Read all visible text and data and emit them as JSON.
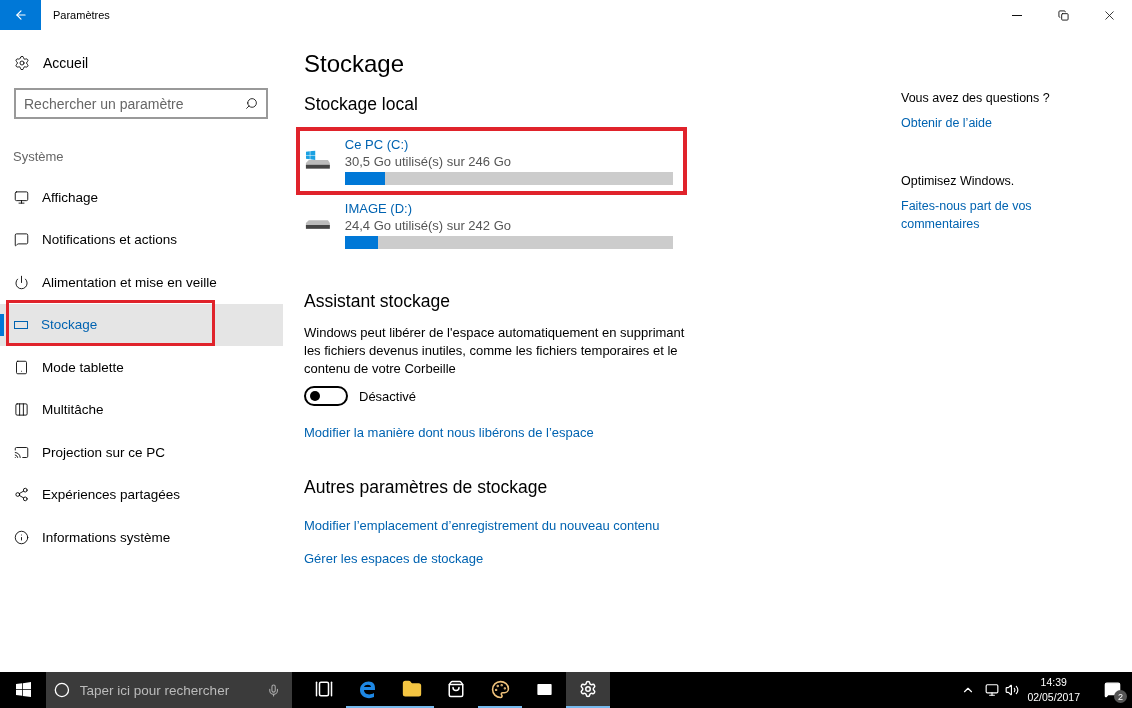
{
  "window": {
    "title": "Paramètres"
  },
  "sidebar": {
    "home": "Accueil",
    "search": {
      "placeholder": "Rechercher un paramètre"
    },
    "section": "Système",
    "items": [
      {
        "label": "Affichage",
        "selected": false,
        "highlighted": false
      },
      {
        "label": "Notifications et actions",
        "selected": false,
        "highlighted": false
      },
      {
        "label": "Alimentation et mise en veille",
        "selected": false,
        "highlighted": false
      },
      {
        "label": "Stockage",
        "selected": true,
        "highlighted": true
      },
      {
        "label": "Mode tablette",
        "selected": false,
        "highlighted": false
      },
      {
        "label": "Multitâche",
        "selected": false,
        "highlighted": false
      },
      {
        "label": "Projection sur ce PC",
        "selected": false,
        "highlighted": false
      },
      {
        "label": "Expériences partagées",
        "selected": false,
        "highlighted": false
      },
      {
        "label": "Informations système",
        "selected": false,
        "highlighted": false
      }
    ]
  },
  "main": {
    "title": "Stockage",
    "local_heading": "Stockage local",
    "drives": [
      {
        "name": "Ce PC (C:)",
        "usage": "30,5 Go utilisé(s) sur 246 Go",
        "level": 0.124,
        "system": true,
        "highlighted": true
      },
      {
        "name": "IMAGE (D:)",
        "usage": "24,4 Go utilisé(s) sur 242 Go",
        "level": 0.101,
        "system": false,
        "highlighted": false
      }
    ],
    "sense": {
      "heading": "Assistant stockage",
      "description": "Windows peut libérer de l'espace automatiquement en supprimant les fichiers devenus inutiles, comme les fichiers temporaires et le contenu de votre Corbeille",
      "toggle": {
        "on": false,
        "label": "Désactivé"
      },
      "link": "Modifier la manière dont nous libérons de l’espace"
    },
    "other": {
      "heading": "Autres paramètres de stockage",
      "links": [
        "Modifier l’emplacement d’enregistrement du nouveau contenu",
        "Gérer les espaces de stockage"
      ]
    }
  },
  "aside": [
    {
      "heading": "Vous avez des questions ?",
      "link": "Obtenir de l’aide"
    },
    {
      "heading": "Optimisez Windows.",
      "link": "Faites-nous part de vos commentaires"
    }
  ],
  "taskbar": {
    "search": {
      "placeholder": "Taper ici pour rechercher"
    },
    "apps": [
      {
        "running": false,
        "active": false
      },
      {
        "running": true,
        "active": false
      },
      {
        "running": true,
        "active": false
      },
      {
        "running": false,
        "active": false
      },
      {
        "running": true,
        "active": false
      },
      {
        "running": false,
        "active": false
      },
      {
        "running": true,
        "active": true
      }
    ],
    "time": "14:39",
    "date": "02/05/2017",
    "notifications": "2"
  }
}
